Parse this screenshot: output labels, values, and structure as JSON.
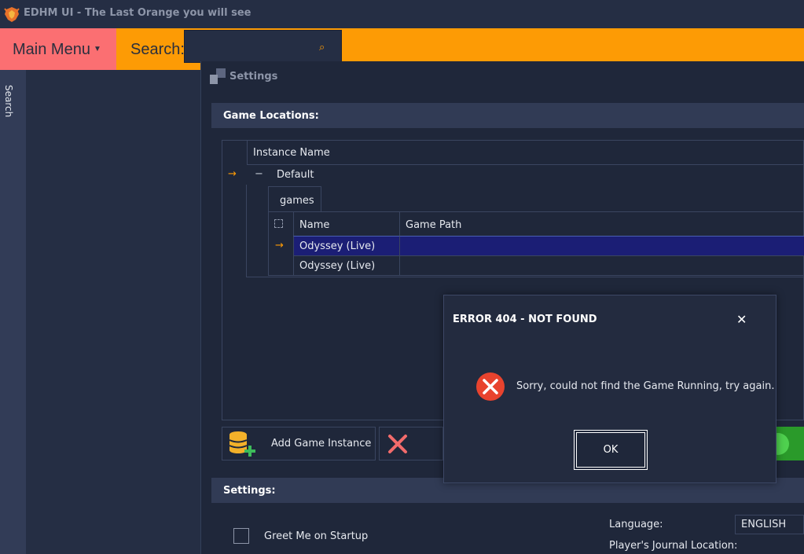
{
  "titlebar": {
    "title": "EDHM UI - The Last Orange you will see"
  },
  "menubar": {
    "main_menu_label": "Main Menu",
    "search_label": "Search:",
    "search_value": "",
    "search_icon": "magnifier-icon"
  },
  "left_strip": {
    "label": "Search"
  },
  "settings_window": {
    "title": "Settings",
    "game_locations": {
      "header": "Game Locations:",
      "grid_header": "Instance Name",
      "instance": "Default",
      "detail_tab": "games",
      "columns": [
        "Name",
        "Game Path"
      ],
      "rows": [
        {
          "name": "Odyssey (Live)",
          "path": "",
          "selected": true
        },
        {
          "name": "Odyssey (Live)",
          "path": "",
          "selected": false
        }
      ],
      "add_button_label": "Add Game Instance"
    },
    "settings_panel": {
      "header": "Settings:",
      "greet_label": "Greet Me on Startup",
      "language_label": "Language:",
      "language_value": "ENGLISH",
      "journal_label": "Player's Journal Location:"
    }
  },
  "dialog": {
    "title": "ERROR 404 - NOT FOUND",
    "message": "Sorry, could not find the Game Running, try again.",
    "ok_label": "OK",
    "close_glyph": "✕"
  },
  "colors": {
    "accent_orange": "#fd9b05",
    "menu_pink": "#fb6f72",
    "background": "#252e44",
    "selection": "#1b1e75",
    "error_red": "#e8432e",
    "success_green": "#2a9a2a"
  }
}
